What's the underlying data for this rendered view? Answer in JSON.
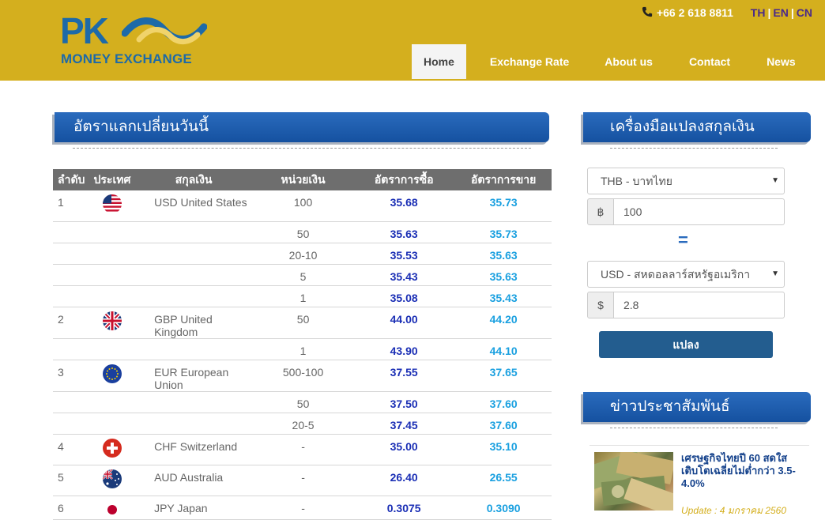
{
  "brand": {
    "logo_mark": "PK",
    "logo_name": "MONEY EXCHANGE",
    "colors": {
      "header": "#d4af1e",
      "primary": "#1d6aa8",
      "heading_bar": "#1f5fae",
      "buy": "#1b2fb5",
      "sell": "#1aa0e0"
    }
  },
  "topbar": {
    "phone_icon": "phone-icon",
    "phone": "+66 2 618 8811",
    "languages": [
      "TH",
      "EN",
      "CN"
    ]
  },
  "nav": [
    {
      "label": "Home",
      "active": true
    },
    {
      "label": "Exchange Rate"
    },
    {
      "label": "About us"
    },
    {
      "label": "Contact"
    },
    {
      "label": "News"
    }
  ],
  "rates": {
    "heading": "อัตราแลกเปลี่ยนวันนี้",
    "columns": [
      "ลำดับ",
      "ประเทศ",
      "สกุลเงิน",
      "หน่วยเงิน",
      "อัตราการซื้อ",
      "อัตราการขาย"
    ],
    "rows": [
      {
        "no": "1",
        "flag": "us-flag-icon",
        "currency": "USD United States",
        "unit": "100",
        "buy": "35.68",
        "sell": "35.73"
      },
      {
        "no": "",
        "flag": "",
        "currency": "",
        "unit": "50",
        "buy": "35.63",
        "sell": "35.73"
      },
      {
        "no": "",
        "flag": "",
        "currency": "",
        "unit": "20-10",
        "buy": "35.53",
        "sell": "35.63"
      },
      {
        "no": "",
        "flag": "",
        "currency": "",
        "unit": "5",
        "buy": "35.43",
        "sell": "35.63"
      },
      {
        "no": "",
        "flag": "",
        "currency": "",
        "unit": "1",
        "buy": "35.08",
        "sell": "35.43"
      },
      {
        "no": "2",
        "flag": "uk-flag-icon",
        "currency": "GBP United Kingdom",
        "unit": "50",
        "buy": "44.00",
        "sell": "44.20"
      },
      {
        "no": "",
        "flag": "",
        "currency": "",
        "unit": "1",
        "buy": "43.90",
        "sell": "44.10"
      },
      {
        "no": "3",
        "flag": "eu-flag-icon",
        "currency": "EUR European Union",
        "unit": "500-100",
        "buy": "37.55",
        "sell": "37.65"
      },
      {
        "no": "",
        "flag": "",
        "currency": "",
        "unit": "50",
        "buy": "37.50",
        "sell": "37.60"
      },
      {
        "no": "",
        "flag": "",
        "currency": "",
        "unit": "20-5",
        "buy": "37.45",
        "sell": "37.60"
      },
      {
        "no": "4",
        "flag": "ch-flag-icon",
        "currency": "CHF Switzerland",
        "unit": "-",
        "buy": "35.00",
        "sell": "35.10"
      },
      {
        "no": "5",
        "flag": "au-flag-icon",
        "currency": "AUD Australia",
        "unit": "-",
        "buy": "26.40",
        "sell": "26.55"
      },
      {
        "no": "6",
        "flag": "jp-flag-icon",
        "currency": "JPY Japan",
        "unit": "-",
        "buy": "0.3075",
        "sell": "0.3090"
      }
    ]
  },
  "converter": {
    "heading": "เครื่องมือแปลงสกุลเงิน",
    "from_currency": "THB - บาทไทย",
    "from_symbol": "฿",
    "from_amount": "100",
    "equals": "=",
    "to_currency": "USD - สหดอลลาร์สหรัฐอเมริกา",
    "to_symbol": "$",
    "to_amount": "2.8",
    "button": "แปลง"
  },
  "news": {
    "heading": "ข่าวประชาสัมพันธ์",
    "items": [
      {
        "title": "เศรษฐกิจไทยปี 60 สดใส เติบโตเฉลี่ยไม่ต่ำกว่า 3.5-4.0%",
        "date": "Update : 4 มกราคม 2560"
      }
    ]
  }
}
